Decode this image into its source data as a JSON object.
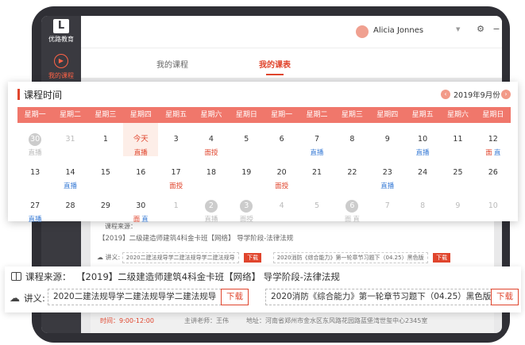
{
  "app": {
    "logo_mark": "L",
    "logo_text": "优路教育",
    "sidebar_item": "我的课程",
    "user_name": "Alicia Jonnes",
    "accent": "#e0452d"
  },
  "tabs": [
    {
      "label": "我的课程",
      "active": false
    },
    {
      "label": "我的课表",
      "active": true
    }
  ],
  "calendar": {
    "title": "课程时间",
    "month": "2019年9月份",
    "weekdays": [
      "星期一",
      "星期二",
      "星期三",
      "星期四",
      "星期五",
      "星期六",
      "星期日",
      "星期一",
      "星期二",
      "星期三",
      "星期四",
      "星期五",
      "星期六",
      "星期日"
    ],
    "days": [
      {
        "n": "30",
        "muted": true,
        "disc": true,
        "tags": [
          {
            "t": "直播",
            "k": "live"
          }
        ]
      },
      {
        "n": "31",
        "muted": true
      },
      {
        "n": "1"
      },
      {
        "n": "今天",
        "today": true,
        "tags": [
          {
            "t": "直播",
            "k": "live"
          }
        ]
      },
      {
        "n": "3"
      },
      {
        "n": "4",
        "tags": [
          {
            "t": "面授",
            "k": "face"
          }
        ]
      },
      {
        "n": "5"
      },
      {
        "n": "6"
      },
      {
        "n": "7",
        "tags": [
          {
            "t": "直播",
            "k": "live"
          }
        ]
      },
      {
        "n": "8"
      },
      {
        "n": "9"
      },
      {
        "n": "10",
        "tags": [
          {
            "t": "直播",
            "k": "live"
          }
        ]
      },
      {
        "n": "11"
      },
      {
        "n": "12",
        "tags": [
          {
            "t": "面",
            "k": "face"
          },
          {
            "t": "直",
            "k": "live"
          }
        ]
      },
      {
        "n": "13"
      },
      {
        "n": "14",
        "tags": [
          {
            "t": "直播",
            "k": "live"
          }
        ]
      },
      {
        "n": "15"
      },
      {
        "n": "16"
      },
      {
        "n": "17",
        "tags": [
          {
            "t": "面授",
            "k": "face"
          }
        ]
      },
      {
        "n": "18"
      },
      {
        "n": "19"
      },
      {
        "n": "20",
        "tags": [
          {
            "t": "面授",
            "k": "face"
          }
        ]
      },
      {
        "n": "21"
      },
      {
        "n": "22"
      },
      {
        "n": "23",
        "tags": [
          {
            "t": "直播",
            "k": "live"
          }
        ]
      },
      {
        "n": "24"
      },
      {
        "n": "25"
      },
      {
        "n": "26"
      },
      {
        "n": "27",
        "tags": [
          {
            "t": "直播",
            "k": "live"
          }
        ]
      },
      {
        "n": "28"
      },
      {
        "n": "29"
      },
      {
        "n": "30",
        "tags": [
          {
            "t": "面",
            "k": "face"
          },
          {
            "t": "直",
            "k": "live"
          }
        ]
      },
      {
        "n": "1",
        "muted": true
      },
      {
        "n": "2",
        "muted": true,
        "disc": true,
        "tags": [
          {
            "t": "直播",
            "k": "live"
          }
        ]
      },
      {
        "n": "3",
        "muted": true,
        "disc": true,
        "tags": [
          {
            "t": "面授",
            "k": "face"
          }
        ]
      },
      {
        "n": "4",
        "muted": true
      },
      {
        "n": "5",
        "muted": true
      },
      {
        "n": "6",
        "muted": true,
        "disc": true,
        "tags": [
          {
            "t": "面",
            "k": "face"
          },
          {
            "t": "直",
            "k": "live"
          }
        ]
      },
      {
        "n": "7",
        "muted": true
      },
      {
        "n": "8",
        "muted": true
      },
      {
        "n": "9",
        "muted": true
      },
      {
        "n": "10",
        "muted": true
      }
    ]
  },
  "course_bg": {
    "source_title": "课程来源：",
    "source_text": "【2019】二级建造师建筑4科金卡班【网络】   导学阶段-法律法规",
    "notes_label": "讲义:",
    "file1": "2020二建法规导学二建法规导学二建法规导",
    "file2": "2020消防《综合能力》第一轮章节习题下（04.25）黑色版",
    "download": "下载",
    "time": "时间：9:00-12:00",
    "teacher": "主讲老师：王伟",
    "address": "地址：河南省郑州市金水区东风路花园路蓝堡湾世玺中心2345室"
  },
  "info": {
    "source_label": "课程来源：",
    "source_value": "【2019】二级建造师建筑4科金卡班【网络】   导学阶段-法律法规",
    "notes_label": "讲义:",
    "file1": "2020二建法规导学二建法规导学二建法规导",
    "file2": "2020消防《综合能力》第一轮章节习题下（04.25）黑色版",
    "download": "下载"
  }
}
